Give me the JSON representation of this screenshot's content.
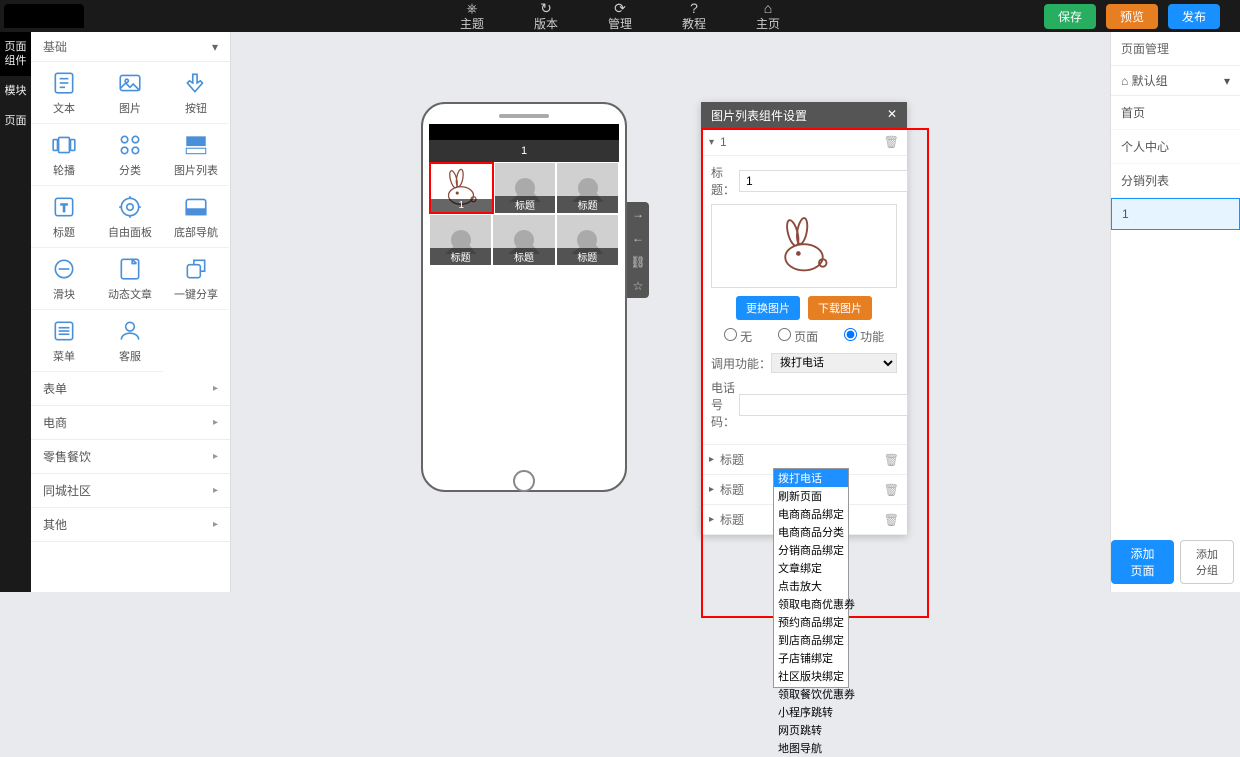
{
  "topnav": [
    {
      "icon": "⎈",
      "label": "主题"
    },
    {
      "icon": "↻",
      "label": "版本"
    },
    {
      "icon": "⟳",
      "label": "管理"
    },
    {
      "icon": "?",
      "label": "教程"
    },
    {
      "icon": "⌂",
      "label": "主页"
    }
  ],
  "top_actions": {
    "save": "保存",
    "preview": "预览",
    "publish": "发布"
  },
  "leftrail": {
    "components": "页面\n组件",
    "modules": "模块",
    "pages": "页面"
  },
  "categories": {
    "basic": "基础",
    "form": "表单",
    "ecommerce": "电商",
    "retail": "零售餐饮",
    "community": "同城社区",
    "other": "其他"
  },
  "components": [
    {
      "label": "文本",
      "icon": "text"
    },
    {
      "label": "图片",
      "icon": "image"
    },
    {
      "label": "按钮",
      "icon": "tap"
    },
    {
      "label": "轮播",
      "icon": "carousel"
    },
    {
      "label": "分类",
      "icon": "grid"
    },
    {
      "label": "图片列表",
      "icon": "imglist"
    },
    {
      "label": "标题",
      "icon": "title"
    },
    {
      "label": "自由面板",
      "icon": "panel"
    },
    {
      "label": "底部导航",
      "icon": "bottomnav"
    },
    {
      "label": "滑块",
      "icon": "slider"
    },
    {
      "label": "动态文章",
      "icon": "article"
    },
    {
      "label": "一键分享",
      "icon": "share"
    },
    {
      "label": "菜单",
      "icon": "menu"
    },
    {
      "label": "客服",
      "icon": "support"
    }
  ],
  "phone": {
    "page_title": "1",
    "tile_label": "标题"
  },
  "settings": {
    "title": "图片列表组件设置",
    "items": [
      {
        "label": "1",
        "expanded": true
      },
      {
        "label": "标题",
        "expanded": false
      },
      {
        "label": "标题",
        "expanded": false
      },
      {
        "label": "标题",
        "expanded": false
      }
    ],
    "field_title_label": "标题：",
    "field_title_value": "1",
    "btn_change": "更换图片",
    "btn_download": "下载图片",
    "radio_none": "无",
    "radio_page": "页面",
    "radio_func": "功能",
    "func_label": "调用功能：",
    "func_value": "拨打电话",
    "phone_label": "电话号码：",
    "phone_value": ""
  },
  "dropdown_options": [
    "拨打电话",
    "刷新页面",
    "电商商品绑定",
    "电商商品分类",
    "分销商品绑定",
    "文章绑定",
    "点击放大",
    "领取电商优惠券",
    "预约商品绑定",
    "到店商品绑定",
    "子店铺绑定",
    "社区版块绑定",
    "领取餐饮优惠券",
    "小程序跳转",
    "网页跳转",
    "地图导航"
  ],
  "pages": {
    "title": "页面管理",
    "group": "默认组",
    "items": [
      "首页",
      "个人中心",
      "分销列表",
      "1"
    ],
    "add_page": "添加页面",
    "add_group": "添加分组"
  }
}
